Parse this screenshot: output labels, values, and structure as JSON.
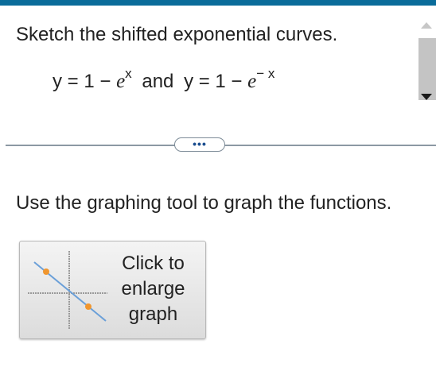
{
  "question": {
    "prompt": "Sketch the shifted exponential curves.",
    "eq1_lhs": "y = 1 − ",
    "e": "e",
    "eq1_exp": "x",
    "conjunction": "and",
    "eq2_lhs": "y = 1 − ",
    "eq2_exp": "− x"
  },
  "expand": {
    "label": "•••"
  },
  "instruction": "Use the graphing tool to graph the functions.",
  "graph_button": {
    "line1": "Click to",
    "line2": "enlarge",
    "line3": "graph",
    "thumbnail_icon": "graph-thumbnail-icon"
  },
  "colors": {
    "accent_bar": "#0a6c9a",
    "thumb_line": "#6a9fd8",
    "thumb_point": "#f0962f"
  }
}
